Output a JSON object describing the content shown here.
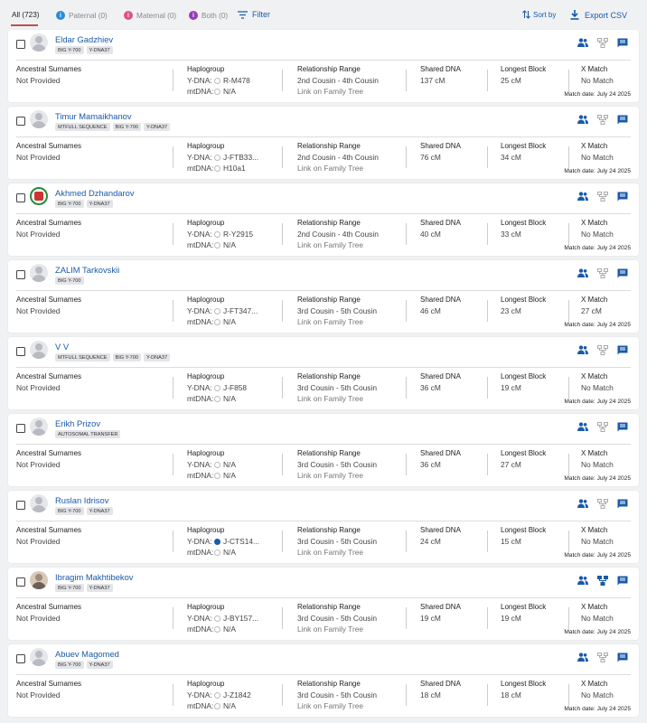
{
  "tabs": {
    "all": "All (723)",
    "paternal": "Paternal (0)",
    "maternal": "Maternal (0)",
    "both": "Both (0)",
    "filter": "Filter",
    "sort": "Sort by",
    "export": "Export CSV"
  },
  "colors": {
    "accent": "#1a5aa8",
    "paternal": "#2a8ad8",
    "maternal": "#e0527a",
    "both": "#9a3ab8",
    "active_tab": "#c0504d"
  },
  "labels": {
    "ancestral": "Ancestral Surnames",
    "haplogroup": "Haplogroup",
    "ydna": "Y-DNA:",
    "mtdna": "mtDNA:",
    "relationship": "Relationship Range",
    "family_tree_link": "Link on Family Tree",
    "shared": "Shared DNA",
    "longest": "Longest Block",
    "xmatch": "X Match",
    "match_date": "Match date: July 24 2025"
  },
  "matches": [
    {
      "name": "Eldar Gadzhiev",
      "avatar": "default",
      "badges": [
        "BIG Y-700",
        "Y-DNA37"
      ],
      "surnames": "Not Provided",
      "ydna": "R-M478",
      "ydna_confirmed": false,
      "mtdna": "N/A",
      "relationship": "2nd Cousin - 4th Cousin",
      "shared": "137 cM",
      "longest": "25 cM",
      "xmatch": "No Match",
      "tree_icon_active": false
    },
    {
      "name": "Timur Mamaikhanov",
      "avatar": "default",
      "badges": [
        "MTFULL SEQUENCE",
        "BIG Y-700",
        "Y-DNA37"
      ],
      "surnames": "Not Provided",
      "ydna": "J-FTB33...",
      "ydna_confirmed": false,
      "mtdna": "H10a1",
      "relationship": "2nd Cousin - 4th Cousin",
      "shared": "76 cM",
      "longest": "34 cM",
      "xmatch": "No Match",
      "tree_icon_active": false
    },
    {
      "name": "Akhmed Dzhandarov",
      "avatar": "flag",
      "badges": [
        "BIG Y-700",
        "Y-DNA37"
      ],
      "surnames": "Not Provided",
      "ydna": "R-Y2915",
      "ydna_confirmed": false,
      "mtdna": "N/A",
      "relationship": "2nd Cousin - 4th Cousin",
      "shared": "40 cM",
      "longest": "33 cM",
      "xmatch": "No Match",
      "tree_icon_active": false
    },
    {
      "name": "ZALIM Tarkovskii",
      "avatar": "default",
      "badges": [
        "BIG Y-700"
      ],
      "surnames": "Not Provided",
      "ydna": "J-FT347...",
      "ydna_confirmed": false,
      "mtdna": "N/A",
      "relationship": "3rd Cousin - 5th Cousin",
      "shared": "46 cM",
      "longest": "23 cM",
      "xmatch": "27 cM",
      "tree_icon_active": false
    },
    {
      "name": "V V",
      "avatar": "default",
      "badges": [
        "MTFULL SEQUENCE",
        "BIG Y-700",
        "Y-DNA37"
      ],
      "surnames": "Not Provided",
      "ydna": "J-F858",
      "ydna_confirmed": false,
      "mtdna": "N/A",
      "relationship": "3rd Cousin - 5th Cousin",
      "shared": "36 cM",
      "longest": "19 cM",
      "xmatch": "No Match",
      "tree_icon_active": false
    },
    {
      "name": "Erikh Prizov",
      "avatar": "default",
      "badges": [
        "AUTOSOMAL TRANSFER"
      ],
      "surnames": "Not Provided",
      "ydna": "N/A",
      "ydna_confirmed": false,
      "mtdna": "N/A",
      "relationship": "3rd Cousin - 5th Cousin",
      "shared": "36 cM",
      "longest": "27 cM",
      "xmatch": "No Match",
      "tree_icon_active": false
    },
    {
      "name": "Ruslan Idrisov",
      "avatar": "default",
      "badges": [
        "BIG Y-700",
        "Y-DNA37"
      ],
      "surnames": "Not Provided",
      "ydna": "J-CTS14...",
      "ydna_confirmed": true,
      "mtdna": "N/A",
      "relationship": "3rd Cousin - 5th Cousin",
      "shared": "24 cM",
      "longest": "15 cM",
      "xmatch": "No Match",
      "tree_icon_active": false
    },
    {
      "name": "Ibragim Makhtibekov",
      "avatar": "photo",
      "badges": [
        "BIG Y-700",
        "Y-DNA37"
      ],
      "surnames": "Not Provided",
      "ydna": "J-BY157...",
      "ydna_confirmed": false,
      "mtdna": "N/A",
      "relationship": "3rd Cousin - 5th Cousin",
      "shared": "19 cM",
      "longest": "19 cM",
      "xmatch": "No Match",
      "tree_icon_active": true
    },
    {
      "name": "Abuev Magomed",
      "avatar": "default",
      "badges": [
        "BIG Y-700",
        "Y-DNA37"
      ],
      "surnames": "Not Provided",
      "ydna": "J-Z1842",
      "ydna_confirmed": false,
      "mtdna": "N/A",
      "relationship": "3rd Cousin - 5th Cousin",
      "shared": "18 cM",
      "longest": "18 cM",
      "xmatch": "No Match",
      "tree_icon_active": false
    }
  ]
}
